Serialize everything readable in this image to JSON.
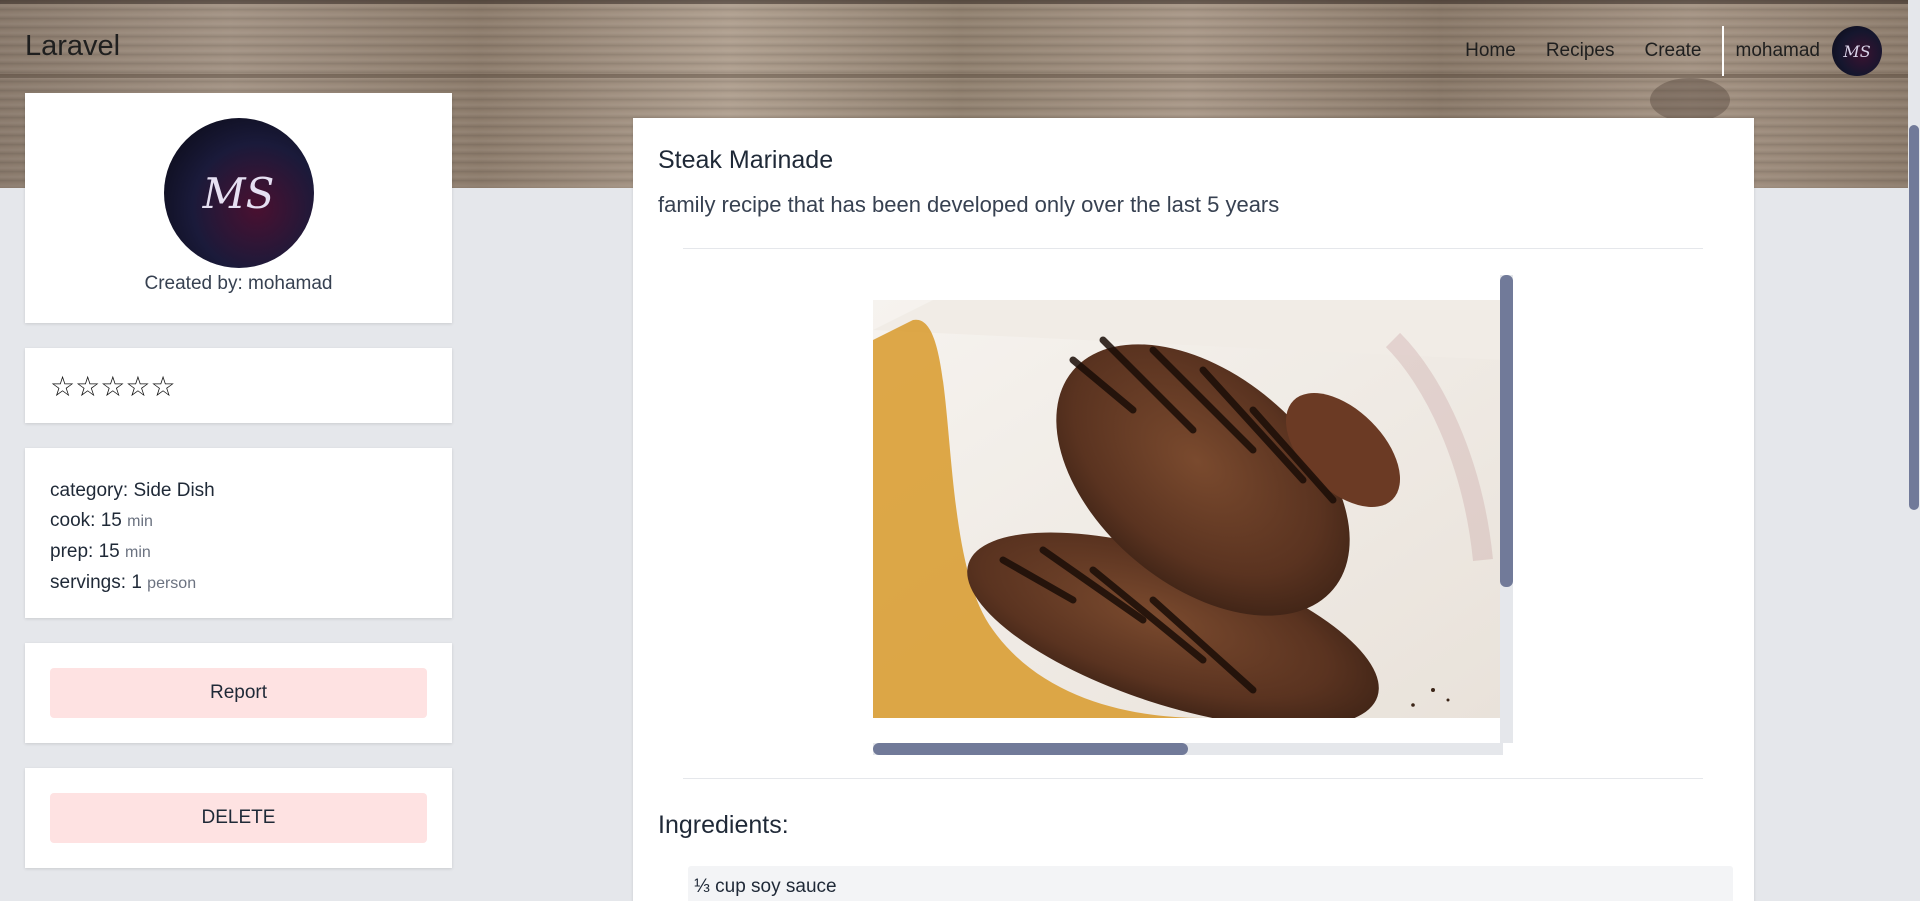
{
  "nav": {
    "brand": "Laravel",
    "links": [
      "Home",
      "Recipes",
      "Create"
    ],
    "user_name": "mohamad",
    "avatar_monogram": "MS"
  },
  "profile": {
    "avatar_monogram": "MS",
    "created_by": "Created by: mohamad"
  },
  "rating": {
    "stars": [
      "☆",
      "☆",
      "☆",
      "☆",
      "☆"
    ],
    "value": 0,
    "max": 5
  },
  "info": {
    "category_label": "category:",
    "category_value": "Side Dish",
    "cook_label": "cook:",
    "cook_value": "15",
    "cook_unit": "min",
    "prep_label": "prep:",
    "prep_value": "15",
    "prep_unit": "min",
    "servings_label": "servings:",
    "servings_value": "1",
    "servings_unit": "person"
  },
  "actions": {
    "report_label": "Report",
    "delete_label": "DELETE"
  },
  "recipe": {
    "title": "Steak Marinade",
    "description": "family recipe that has been developed only over the last 5 years",
    "image_alt": "steak-photo",
    "ingredients_title": "Ingredients:",
    "ingredients": [
      "⅓ cup soy sauce"
    ]
  },
  "scroll": {
    "image_horizontal_fraction": 0.5,
    "image_vertical_fraction": 0.67
  },
  "colors": {
    "accent": "#717a99",
    "danger_bg": "#fee2e2",
    "page_bg": "#e5e7eb"
  }
}
